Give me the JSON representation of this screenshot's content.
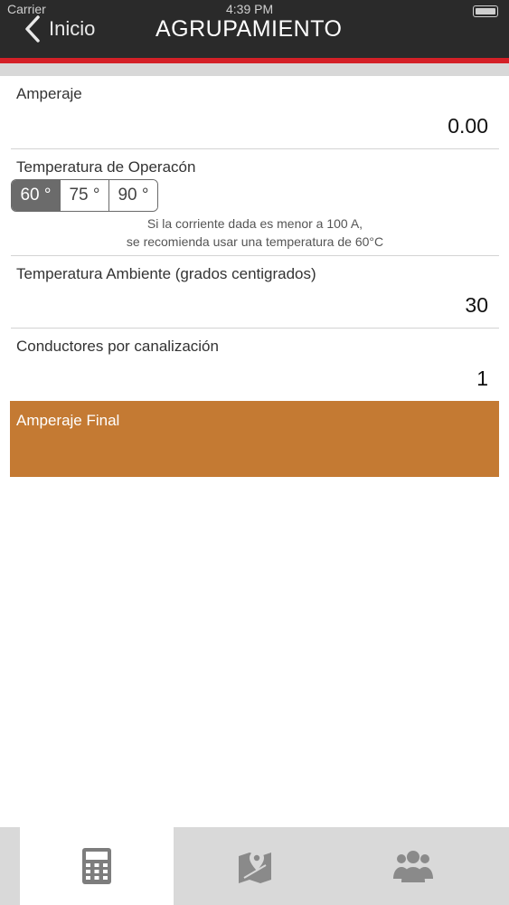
{
  "status": {
    "carrier": "Carrier",
    "time": "4:39 PM"
  },
  "nav": {
    "back_label": "Inicio",
    "title": "AGRUPAMIENTO"
  },
  "amperaje": {
    "label": "Amperaje",
    "value": "0.00"
  },
  "temperatura_operacion": {
    "label": "Temperatura de Operacón",
    "options": [
      "60 °",
      "75 °",
      "90 °"
    ],
    "selected": "60 °",
    "hint_line1": "Si la corriente dada es menor a 100 A,",
    "hint_line2": "se recomienda usar una temperatura de 60°C"
  },
  "temperatura_ambiente": {
    "label": "Temperatura Ambiente (grados centigrados)",
    "value": "30"
  },
  "conductores": {
    "label": "Conductores por canalización",
    "value": "1"
  },
  "amperaje_final": {
    "label": "Amperaje Final",
    "color": "#c47a33"
  },
  "tabs": [
    {
      "icon": "calculator-icon",
      "selected": true
    },
    {
      "icon": "map-pin-icon",
      "selected": false
    },
    {
      "icon": "group-icon",
      "selected": false
    }
  ],
  "colors": {
    "navbar": "#2a2a2a",
    "accent_red": "#d42027",
    "selected_segment": "#6b6b6b"
  }
}
